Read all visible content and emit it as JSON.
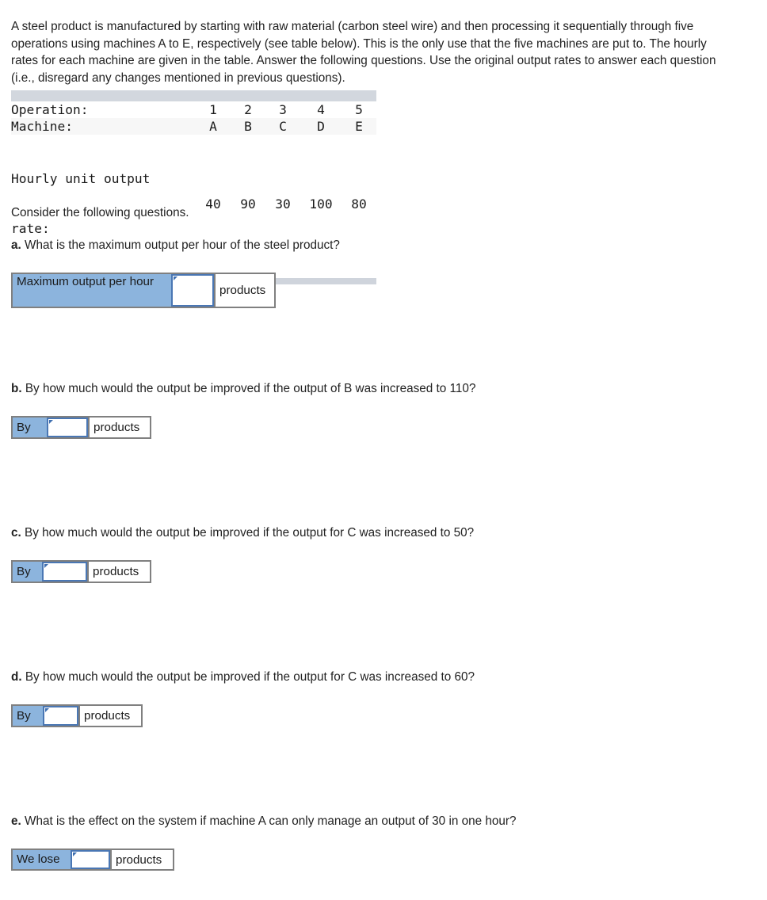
{
  "intro": "A steel product is manufactured by starting with raw material (carbon steel wire) and then processing it sequentially through five operations using machines A to E, respectively (see table below). This is the only use that the five machines are put to. The hourly rates for each machine are given in the table. Answer the following questions. Use the original output rates to answer each question (i.e., disregard any changes mentioned in previous questions).",
  "rates_table": {
    "rows": [
      {
        "label": "Operation:",
        "values": [
          "1",
          "2",
          "3",
          "4",
          "5"
        ]
      },
      {
        "label": "Machine:",
        "values": [
          "A",
          "B",
          "C",
          "D",
          "E"
        ]
      },
      {
        "label_line1": "Hourly unit output",
        "label_line2": "rate:",
        "values": [
          "40",
          "90",
          "30",
          "100",
          "80"
        ]
      }
    ]
  },
  "lead_text": "Consider the following questions.",
  "questions": [
    {
      "letter": "a.",
      "text": "What is the maximum output per hour of the steel product?",
      "answer": {
        "label": "Maximum output per hour",
        "value": "",
        "placeholder": "",
        "unit": "products"
      }
    },
    {
      "letter": "b.",
      "text": "By how much would the output be improved if the output of B was increased to 110?",
      "answer": {
        "label": "By",
        "value": "",
        "placeholder": "",
        "unit": "products"
      }
    },
    {
      "letter": "c.",
      "text": "By how much would the output be improved if the output for C was increased to 50?",
      "answer": {
        "label": "By",
        "value": "",
        "placeholder": "",
        "unit": "products"
      }
    },
    {
      "letter": "d.",
      "text": "By how much would the output be improved if the output for C was increased to 60?",
      "answer": {
        "label": "By",
        "value": "",
        "placeholder": "",
        "unit": "products"
      }
    },
    {
      "letter": "e.",
      "text": "What is the effect on the system if machine A can only manage an output of 30 in one hour?",
      "answer": {
        "label": "We lose",
        "value": "",
        "placeholder": "",
        "unit": "products"
      }
    }
  ],
  "colors": {
    "label_blue": "#8cb4dd",
    "input_border_blue": "#4a77b4",
    "cell_border_gray": "#808080",
    "table_band": "#d2d7de",
    "stripe": "#f7f7f7"
  }
}
